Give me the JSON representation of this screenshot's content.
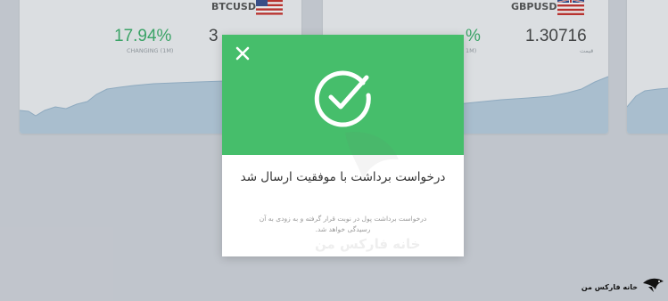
{
  "cards": [
    {
      "pair": "BTCUSD",
      "change_value": "17.94%",
      "change_label": "CHANGING (1M)",
      "price_value_partial": "3"
    },
    {
      "pair": "GBPUSD",
      "change_value_partial": "%",
      "change_label_partial": "1M)",
      "price_value": "1.30716",
      "price_label": "قیمت"
    }
  ],
  "colors": {
    "accent_green": "#46be6b",
    "change_green": "#3cb06a",
    "chart_fill": "#b9cfe0",
    "chart_line": "#9bb8cf"
  },
  "modal": {
    "close_icon": "close-icon",
    "status_icon": "check-circle-icon",
    "title": "درخواست برداشت با موفقیت ارسال شد",
    "message": "درخواست برداشت پول در نوبت قرار گرفته و به زودی به آن رسیدگی خواهد شد."
  },
  "watermark": {
    "text": "خانه فارکس من"
  },
  "logo": {
    "text": "خانه فارکس من"
  }
}
